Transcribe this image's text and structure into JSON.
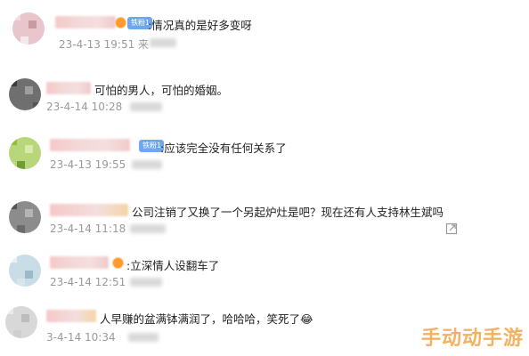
{
  "comments": [
    {
      "text": ":情况真的是好多变呀",
      "meta": "23-4-13 19:51 来",
      "badge": "铁粉1"
    },
    {
      "text": "可怕的男人，可怕的婚姻。",
      "meta": "23-4-14 10:28"
    },
    {
      "text": ":应该完全没有任何关系了",
      "meta": "23-4-13 19:55",
      "badge": "铁粉1"
    },
    {
      "text": "公司注销了又换了一个另起炉灶是吧？现在还有人支持林生斌吗",
      "meta": "23-4-14 11:18"
    },
    {
      "text": ":立深情人设翻车了",
      "meta": "23-4-14 12:51"
    },
    {
      "text": "人早赚的盆满钵满润了，哈哈哈，笑死了😂",
      "meta": "3-4-14 10:34"
    }
  ],
  "watermark": "手动动手游",
  "icons": {
    "share": "share-icon",
    "vip": "vip-crown-icon"
  },
  "colors": {
    "badge": "#6fa7ef",
    "watermark": "#f4b160",
    "meta": "#9a9a9a"
  }
}
